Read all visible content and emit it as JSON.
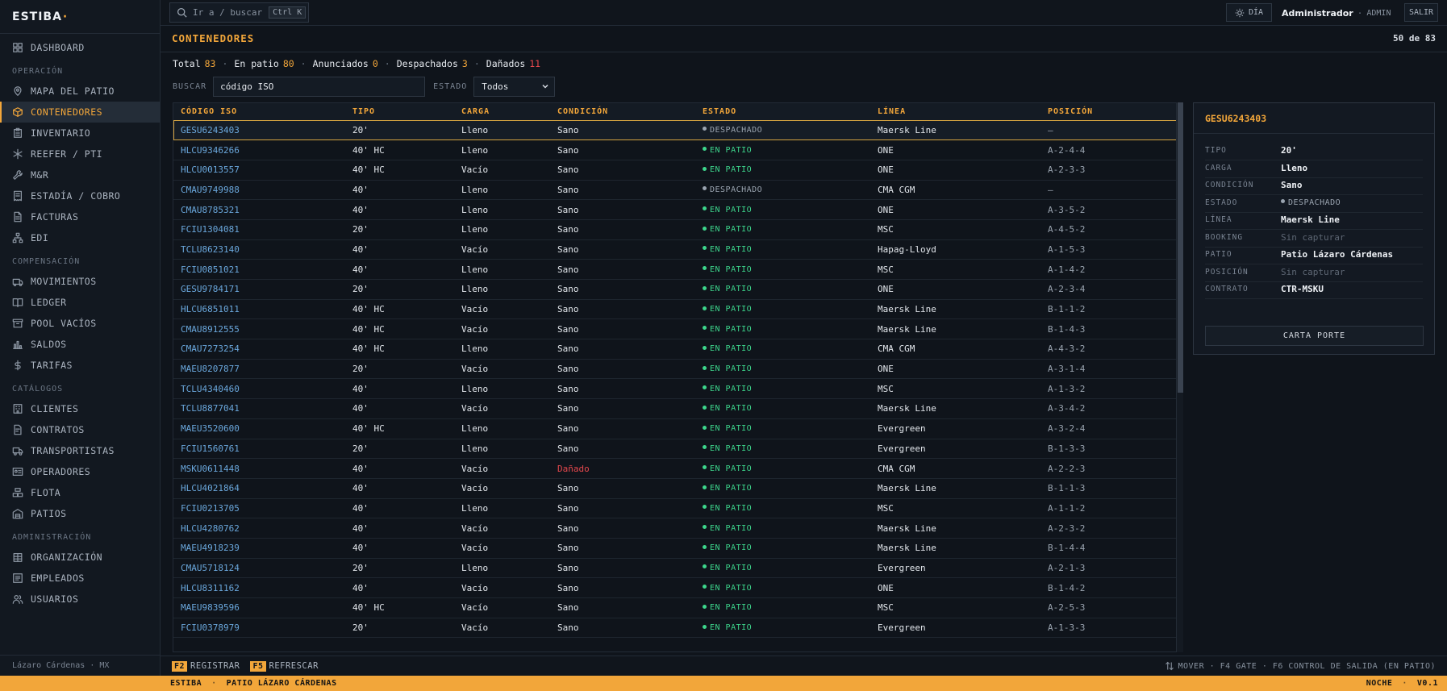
{
  "brand": {
    "name": "ESTIBA",
    "dot": "·"
  },
  "nav": {
    "top": [
      {
        "label": "DASHBOARD",
        "icon": "dashboard-icon"
      }
    ],
    "sections": [
      {
        "title": "OPERACIÓN",
        "items": [
          {
            "label": "MAPA DEL PATIO",
            "icon": "map-pin-icon"
          },
          {
            "label": "CONTENEDORES",
            "icon": "box-icon",
            "active": true
          },
          {
            "label": "INVENTARIO",
            "icon": "clipboard-icon"
          },
          {
            "label": "REEFER / PTI",
            "icon": "snowflake-icon"
          },
          {
            "label": "M&R",
            "icon": "wrench-icon"
          },
          {
            "label": "ESTADÍA / COBRO",
            "icon": "receipt-icon"
          },
          {
            "label": "FACTURAS",
            "icon": "document-icon"
          },
          {
            "label": "EDI",
            "icon": "network-icon"
          }
        ]
      },
      {
        "title": "COMPENSACIÓN",
        "items": [
          {
            "label": "MOVIMIENTOS",
            "icon": "arrows-icon"
          },
          {
            "label": "LEDGER",
            "icon": "book-icon"
          },
          {
            "label": "POOL VACÍOS",
            "icon": "archive-icon"
          },
          {
            "label": "SALDOS",
            "icon": "bar-chart-icon"
          },
          {
            "label": "TARIFAS",
            "icon": "dollar-icon"
          }
        ]
      },
      {
        "title": "CATÁLOGOS",
        "items": [
          {
            "label": "CLIENTES",
            "icon": "building-icon"
          },
          {
            "label": "CONTRATOS",
            "icon": "contract-icon"
          },
          {
            "label": "TRANSPORTISTAS",
            "icon": "truck-icon"
          },
          {
            "label": "OPERADORES",
            "icon": "id-card-icon"
          },
          {
            "label": "FLOTA",
            "icon": "stack-icon"
          },
          {
            "label": "PATIOS",
            "icon": "warehouse-icon"
          }
        ]
      },
      {
        "title": "ADMINISTRACIÓN",
        "items": [
          {
            "label": "ORGANIZACIÓN",
            "icon": "org-icon"
          },
          {
            "label": "EMPLEADOS",
            "icon": "employees-icon"
          },
          {
            "label": "USUARIOS",
            "icon": "users-icon"
          }
        ]
      }
    ],
    "footer": "Lázaro Cárdenas · MX"
  },
  "topbar": {
    "search_placeholder": "Ir a / buscar",
    "search_shortcut": "Ctrl K",
    "theme_label": "DÍA",
    "user_name": "Administrador",
    "user_sep": "·",
    "user_role": "ADMIN",
    "logout_label": "SALIR"
  },
  "page": {
    "title": "CONTENEDORES",
    "count": "50 de 83"
  },
  "stats": [
    {
      "label": "Total",
      "value": "83",
      "color": "#f2a63a"
    },
    {
      "label": "En patio",
      "value": "80",
      "color": "#f2a63a"
    },
    {
      "label": "Anunciados",
      "value": "0",
      "color": "#f2a63a"
    },
    {
      "label": "Despachados",
      "value": "3",
      "color": "#f2a63a"
    },
    {
      "label": "Dañados",
      "value": "11",
      "color": "#e5484d"
    }
  ],
  "filters": {
    "search_label": "BUSCAR",
    "search_placeholder": "código ISO",
    "state_label": "ESTADO",
    "state_value": "Todos"
  },
  "table": {
    "columns": [
      "CÓDIGO ISO",
      "TIPO",
      "CARGA",
      "CONDICIÓN",
      "ESTADO",
      "LÍNEA",
      "POSICIÓN"
    ],
    "rows": [
      [
        "GESU6243403",
        "20'",
        "Lleno",
        "Sano",
        "DESPACHADO",
        "Maersk Line",
        "—"
      ],
      [
        "HLCU9346266",
        "40' HC",
        "Lleno",
        "Sano",
        "EN PATIO",
        "ONE",
        "A-2-4-4"
      ],
      [
        "HLCU0013557",
        "40' HC",
        "Vacío",
        "Sano",
        "EN PATIO",
        "ONE",
        "A-2-3-3"
      ],
      [
        "CMAU9749988",
        "40'",
        "Lleno",
        "Sano",
        "DESPACHADO",
        "CMA CGM",
        "—"
      ],
      [
        "CMAU8785321",
        "40'",
        "Lleno",
        "Sano",
        "EN PATIO",
        "ONE",
        "A-3-5-2"
      ],
      [
        "FCIU1304081",
        "20'",
        "Lleno",
        "Sano",
        "EN PATIO",
        "MSC",
        "A-4-5-2"
      ],
      [
        "TCLU8623140",
        "40'",
        "Vacío",
        "Sano",
        "EN PATIO",
        "Hapag-Lloyd",
        "A-1-5-3"
      ],
      [
        "FCIU0851021",
        "40'",
        "Lleno",
        "Sano",
        "EN PATIO",
        "MSC",
        "A-1-4-2"
      ],
      [
        "GESU9784171",
        "20'",
        "Lleno",
        "Sano",
        "EN PATIO",
        "ONE",
        "A-2-3-4"
      ],
      [
        "HLCU6851011",
        "40' HC",
        "Vacío",
        "Sano",
        "EN PATIO",
        "Maersk Line",
        "B-1-1-2"
      ],
      [
        "CMAU8912555",
        "40' HC",
        "Vacío",
        "Sano",
        "EN PATIO",
        "Maersk Line",
        "B-1-4-3"
      ],
      [
        "CMAU7273254",
        "40' HC",
        "Lleno",
        "Sano",
        "EN PATIO",
        "CMA CGM",
        "A-4-3-2"
      ],
      [
        "MAEU8207877",
        "20'",
        "Vacío",
        "Sano",
        "EN PATIO",
        "ONE",
        "A-3-1-4"
      ],
      [
        "TCLU4340460",
        "40'",
        "Lleno",
        "Sano",
        "EN PATIO",
        "MSC",
        "A-1-3-2"
      ],
      [
        "TCLU8877041",
        "40'",
        "Vacío",
        "Sano",
        "EN PATIO",
        "Maersk Line",
        "A-3-4-2"
      ],
      [
        "MAEU3520600",
        "40' HC",
        "Lleno",
        "Sano",
        "EN PATIO",
        "Evergreen",
        "A-3-2-4"
      ],
      [
        "FCIU1560761",
        "20'",
        "Lleno",
        "Sano",
        "EN PATIO",
        "Evergreen",
        "B-1-3-3"
      ],
      [
        "MSKU0611448",
        "40'",
        "Vacío",
        "Dañado",
        "EN PATIO",
        "CMA CGM",
        "A-2-2-3"
      ],
      [
        "HLCU4021864",
        "40'",
        "Vacío",
        "Sano",
        "EN PATIO",
        "Maersk Line",
        "B-1-1-3"
      ],
      [
        "FCIU0213705",
        "40'",
        "Lleno",
        "Sano",
        "EN PATIO",
        "MSC",
        "A-1-1-2"
      ],
      [
        "HLCU4280762",
        "40'",
        "Vacío",
        "Sano",
        "EN PATIO",
        "Maersk Line",
        "A-2-3-2"
      ],
      [
        "MAEU4918239",
        "40'",
        "Vacío",
        "Sano",
        "EN PATIO",
        "Maersk Line",
        "B-1-4-4"
      ],
      [
        "CMAU5718124",
        "20'",
        "Lleno",
        "Sano",
        "EN PATIO",
        "Evergreen",
        "A-2-1-3"
      ],
      [
        "HLCU8311162",
        "40'",
        "Vacío",
        "Sano",
        "EN PATIO",
        "ONE",
        "B-1-4-2"
      ],
      [
        "MAEU9839596",
        "40' HC",
        "Vacío",
        "Sano",
        "EN PATIO",
        "MSC",
        "A-2-5-3"
      ],
      [
        "FCIU0378979",
        "20'",
        "Vacío",
        "Sano",
        "EN PATIO",
        "Evergreen",
        "A-1-3-3"
      ]
    ]
  },
  "detail": {
    "title": "GESU6243403",
    "fields": [
      {
        "key": "TIPO",
        "value": "20'"
      },
      {
        "key": "CARGA",
        "value": "Lleno"
      },
      {
        "key": "CONDICIÓN",
        "value": "Sano"
      },
      {
        "key": "ESTADO",
        "value": "DESPACHADO"
      },
      {
        "key": "LÍNEA",
        "value": "Maersk Line"
      },
      {
        "key": "BOOKING",
        "value": "Sin capturar"
      },
      {
        "key": "PATIO",
        "value": "Patio Lázaro Cárdenas"
      },
      {
        "key": "POSICIÓN",
        "value": "Sin capturar"
      },
      {
        "key": "CONTRATO",
        "value": "CTR-MSKU"
      }
    ],
    "button_label": "CARTA PORTE"
  },
  "shortcuts": {
    "left": [
      {
        "key": "F2",
        "label": "REGISTRAR"
      },
      {
        "key": "F5",
        "label": "REFRESCAR"
      }
    ],
    "right": "MOVER · F4 GATE · F6 CONTROL DE SALIDA (EN PATIO)"
  },
  "statusbar": {
    "app": "ESTIBA",
    "sep": "·",
    "yard": "PATIO LÁZARO CÁRDENAS",
    "mode": "NOCHE",
    "version": "V0.1"
  },
  "colors": {
    "accent": "#f2a63a",
    "danger": "#e5484d",
    "ok": "#3dd68c",
    "link": "#6aa7dc"
  }
}
